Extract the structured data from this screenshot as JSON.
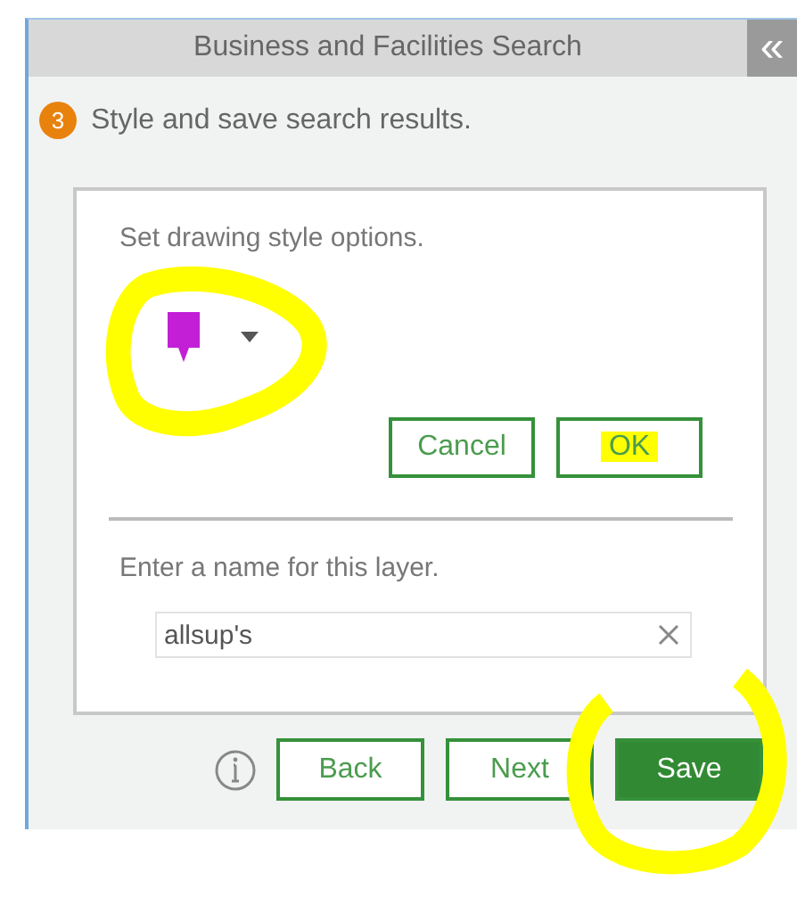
{
  "panel": {
    "title": "Business and Facilities Search",
    "collapse_icon": "«"
  },
  "step": {
    "number": "3",
    "text": "Style and save search results."
  },
  "style_section": {
    "label": "Set drawing style options.",
    "circled": true
  },
  "style_buttons": [
    {
      "label": "Cancel",
      "highlighted": false
    },
    {
      "label": "OK",
      "highlighted": true
    }
  ],
  "name_section": {
    "label": "Enter a name for this layer.",
    "value": "allsup's"
  },
  "footer_buttons": [
    {
      "label": "Back",
      "kind": "outline",
      "circled": false
    },
    {
      "label": "Next",
      "kind": "outline",
      "circled": false
    },
    {
      "label": "Save",
      "kind": "primary",
      "circled": true
    }
  ]
}
